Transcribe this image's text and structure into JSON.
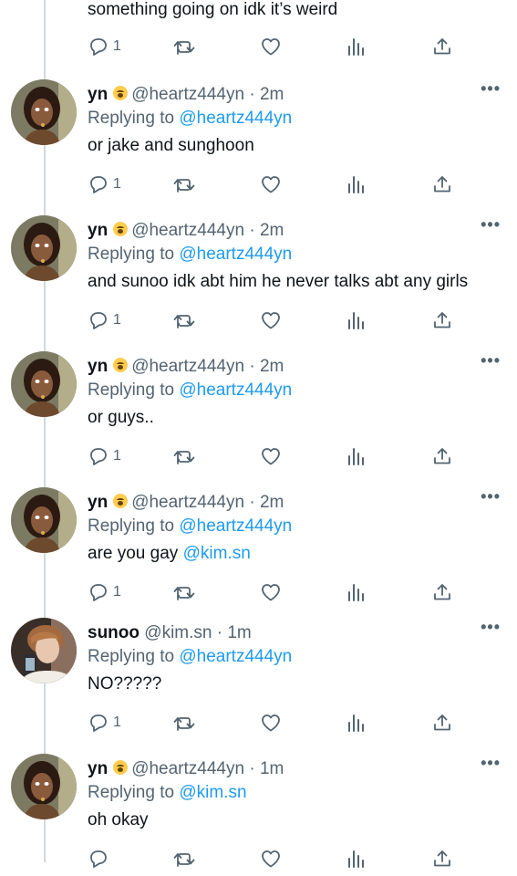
{
  "top_tweet": {
    "text": "something going on idk it’s weird",
    "replies": "1"
  },
  "tweets": [
    {
      "name": "yn",
      "handle": "@heartz444yn",
      "time": "· 2m",
      "replying_label": "Replying to",
      "replying_to": "@heartz444yn",
      "text": "or jake and sunghoon",
      "replies": "1",
      "avatar": "yn-avatar"
    },
    {
      "name": "yn",
      "handle": "@heartz444yn",
      "time": "· 2m",
      "replying_label": "Replying to",
      "replying_to": "@heartz444yn",
      "text": "and sunoo idk abt him he never talks abt any girls",
      "replies": "1",
      "avatar": "yn-avatar"
    },
    {
      "name": "yn",
      "handle": "@heartz444yn",
      "time": "· 2m",
      "replying_label": "Replying to",
      "replying_to": "@heartz444yn",
      "text": "or guys..",
      "replies": "1",
      "avatar": "yn-avatar"
    },
    {
      "name": "yn",
      "handle": "@heartz444yn",
      "time": "· 2m",
      "replying_label": "Replying to",
      "replying_to": "@heartz444yn",
      "text_prefix": "are you gay ",
      "text_mention": "@kim.sn",
      "replies": "1",
      "avatar": "yn-avatar"
    },
    {
      "name": "sunoo",
      "handle": "@kim.sn",
      "time": "· 1m",
      "replying_label": "Replying to",
      "replying_to": "@heartz444yn",
      "text": "NO?????",
      "replies": "1",
      "avatar": "sunoo-avatar"
    },
    {
      "name": "yn",
      "handle": "@heartz444yn",
      "time": "· 1m",
      "replying_label": "Replying to",
      "replying_to": "@kim.sn",
      "text": "oh okay",
      "replies": "",
      "avatar": "yn-avatar"
    }
  ],
  "icons": {
    "reply": "reply-icon",
    "retweet": "retweet-icon",
    "like": "heart-icon",
    "views": "analytics-icon",
    "share": "share-icon",
    "more": "more-icon"
  },
  "colors": {
    "text": "#0f1419",
    "secondary": "#536471",
    "link": "#1d9bf0",
    "thread_line": "#cfd9de"
  }
}
